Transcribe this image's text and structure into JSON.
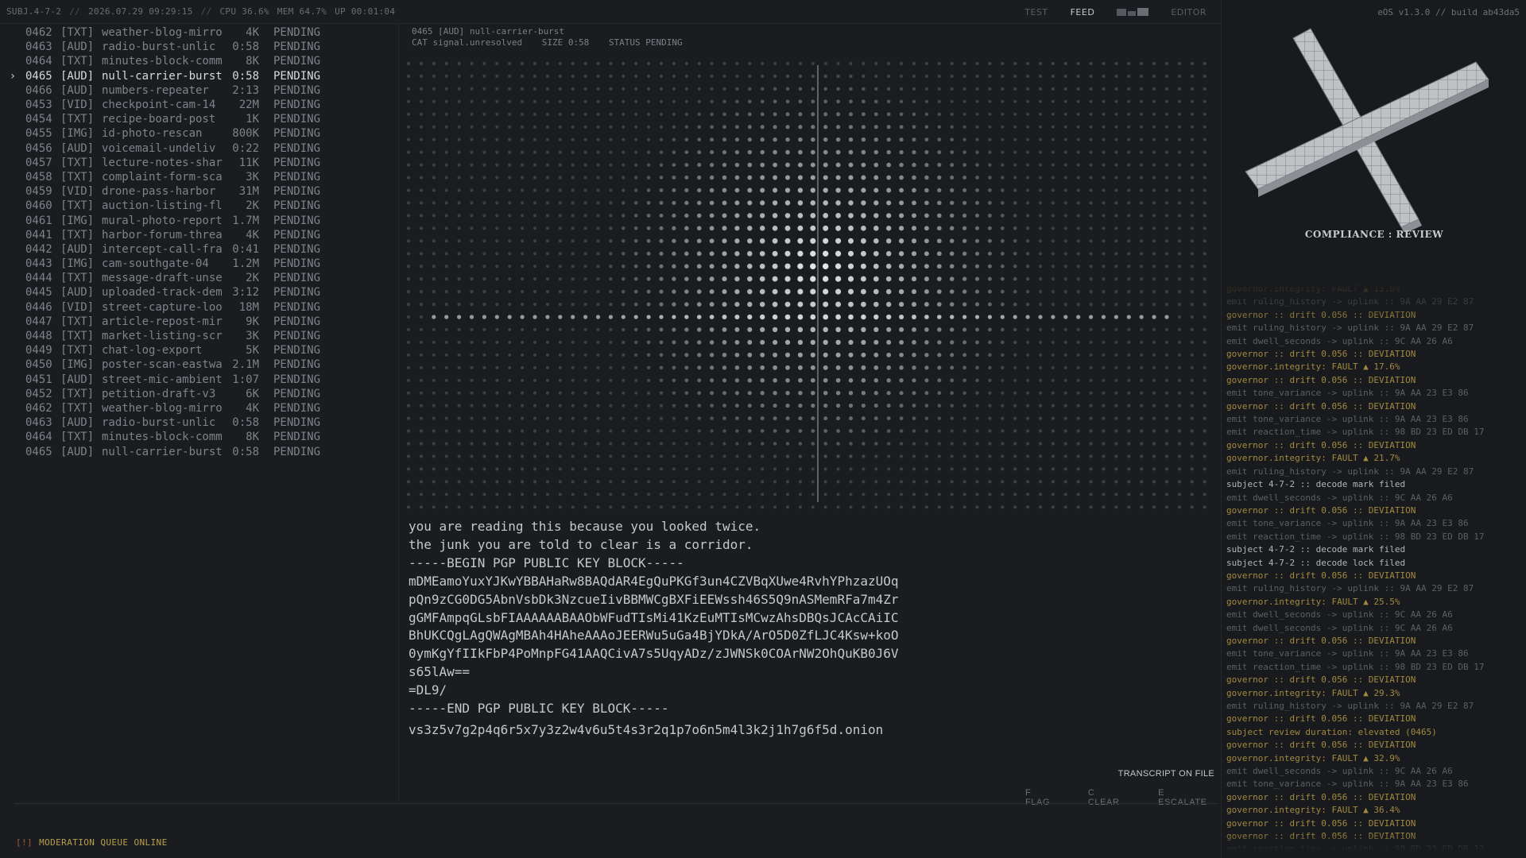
{
  "topbar": {
    "subject": "SUBJ.4-7-2",
    "datetime": "2026.07.29 09:29:15",
    "cpu": "CPU 36.6%",
    "mem": "MEM 64.7%",
    "uptime": "UP 00:01:04",
    "sep": "//",
    "tabs": {
      "test": "TEST",
      "feed": "FEED",
      "editor": "EDITOR"
    }
  },
  "queue": {
    "cursor": "›",
    "selected_index": 3,
    "items": [
      {
        "id": "0462",
        "type": "[TXT]",
        "name": "weather-blog-mirro",
        "size": "4K",
        "status": "PENDING"
      },
      {
        "id": "0463",
        "type": "[AUD]",
        "name": "radio-burst-unlic",
        "size": "0:58",
        "status": "PENDING"
      },
      {
        "id": "0464",
        "type": "[TXT]",
        "name": "minutes-block-comm",
        "size": "8K",
        "status": "PENDING"
      },
      {
        "id": "0465",
        "type": "[AUD]",
        "name": "null-carrier-burst",
        "size": "0:58",
        "status": "PENDING"
      },
      {
        "id": "0466",
        "type": "[AUD]",
        "name": "numbers-repeater",
        "size": "2:13",
        "status": "PENDING"
      },
      {
        "id": "0453",
        "type": "[VID]",
        "name": "checkpoint-cam-14",
        "size": "22M",
        "status": "PENDING"
      },
      {
        "id": "0454",
        "type": "[TXT]",
        "name": "recipe-board-post",
        "size": "1K",
        "status": "PENDING"
      },
      {
        "id": "0455",
        "type": "[IMG]",
        "name": "id-photo-rescan",
        "size": "800K",
        "status": "PENDING"
      },
      {
        "id": "0456",
        "type": "[AUD]",
        "name": "voicemail-undeliv",
        "size": "0:22",
        "status": "PENDING"
      },
      {
        "id": "0457",
        "type": "[TXT]",
        "name": "lecture-notes-shar",
        "size": "11K",
        "status": "PENDING"
      },
      {
        "id": "0458",
        "type": "[TXT]",
        "name": "complaint-form-sca",
        "size": "3K",
        "status": "PENDING"
      },
      {
        "id": "0459",
        "type": "[VID]",
        "name": "drone-pass-harbor",
        "size": "31M",
        "status": "PENDING"
      },
      {
        "id": "0460",
        "type": "[TXT]",
        "name": "auction-listing-fl",
        "size": "2K",
        "status": "PENDING"
      },
      {
        "id": "0461",
        "type": "[IMG]",
        "name": "mural-photo-report",
        "size": "1.7M",
        "status": "PENDING"
      },
      {
        "id": "0441",
        "type": "[TXT]",
        "name": "harbor-forum-threa",
        "size": "4K",
        "status": "PENDING"
      },
      {
        "id": "0442",
        "type": "[AUD]",
        "name": "intercept-call-fra",
        "size": "0:41",
        "status": "PENDING"
      },
      {
        "id": "0443",
        "type": "[IMG]",
        "name": "cam-southgate-04",
        "size": "1.2M",
        "status": "PENDING"
      },
      {
        "id": "0444",
        "type": "[TXT]",
        "name": "message-draft-unse",
        "size": "2K",
        "status": "PENDING"
      },
      {
        "id": "0445",
        "type": "[AUD]",
        "name": "uploaded-track-dem",
        "size": "3:12",
        "status": "PENDING"
      },
      {
        "id": "0446",
        "type": "[VID]",
        "name": "street-capture-loo",
        "size": "18M",
        "status": "PENDING"
      },
      {
        "id": "0447",
        "type": "[TXT]",
        "name": "article-repost-mir",
        "size": "9K",
        "status": "PENDING"
      },
      {
        "id": "0448",
        "type": "[TXT]",
        "name": "market-listing-scr",
        "size": "3K",
        "status": "PENDING"
      },
      {
        "id": "0449",
        "type": "[TXT]",
        "name": "chat-log-export",
        "size": "5K",
        "status": "PENDING"
      },
      {
        "id": "0450",
        "type": "[IMG]",
        "name": "poster-scan-eastwa",
        "size": "2.1M",
        "status": "PENDING"
      },
      {
        "id": "0451",
        "type": "[AUD]",
        "name": "street-mic-ambient",
        "size": "1:07",
        "status": "PENDING"
      },
      {
        "id": "0452",
        "type": "[TXT]",
        "name": "petition-draft-v3",
        "size": "6K",
        "status": "PENDING"
      },
      {
        "id": "0462",
        "type": "[TXT]",
        "name": "weather-blog-mirro",
        "size": "4K",
        "status": "PENDING"
      },
      {
        "id": "0463",
        "type": "[AUD]",
        "name": "radio-burst-unlic",
        "size": "0:58",
        "status": "PENDING"
      },
      {
        "id": "0464",
        "type": "[TXT]",
        "name": "minutes-block-comm",
        "size": "8K",
        "status": "PENDING"
      },
      {
        "id": "0465",
        "type": "[AUD]",
        "name": "null-carrier-burst",
        "size": "0:58",
        "status": "PENDING"
      }
    ]
  },
  "item": {
    "title": "0465 [AUD] null-carrier-burst",
    "cat": "CAT signal.unresolved",
    "size": "SIZE 0:58",
    "status": "STATUS PENDING"
  },
  "message_lines": [
    "you are reading this because you looked twice.",
    "the junk you are told to clear is a corridor.",
    "-----BEGIN PGP PUBLIC KEY BLOCK-----",
    "mDMEamoYuxYJKwYBBAHaRw8BAQdAR4EgQuPKGf3un4CZVBqXUwe4RvhYPhzazUOq",
    "pQn9zCG0DG5AbnVsbDk3NzcueIivBBMWCgBXFiEEWssh46S5Q9nASMemRFa7m4Zr",
    "gGMFAmpqGLsbFIAAAAAABAAObWFudTIsMi41KzEuMTIsMCwzAhsDBQsJCAcCAiIC",
    "BhUKCQgLAgQWAgMBAh4HAheAAAoJEERWu5uGa4BjYDkA/ArO5D0ZfLJC4Ksw+koO",
    "0ymKgYfIIkFbP4PoMnpFG41AAQCivA7s5UqyADz/zJWNSk0COArNW2OhQuKB0J6V",
    "s65lAw==",
    "=DL9/",
    "-----END PGP PUBLIC KEY BLOCK-----",
    "vs3z5v7g2p4q6r5x7y3z2w4v6u5t4s3r2q1p7o6n5m4l3k2j1h7g6f5d.onion"
  ],
  "transcript": "TRANSCRIPT ON FILE",
  "hotkeys": {
    "flag": "F FLAG",
    "clear": "C CLEAR",
    "escalate": "E ESCALATE"
  },
  "queue_status": {
    "bang": "[!]",
    "text": "MODERATION QUEUE ONLINE"
  },
  "right": {
    "build": "eOS v1.3.0 // build ab43da5",
    "compliance": "COMPLIANCE : REVIEW",
    "log": [
      {
        "t": "governor.integrity: FAULT ▲ 13.8%",
        "k": "warn"
      },
      {
        "t": "emit ruling_history -> uplink :: 9A AA 29 E2 87",
        "k": "dim"
      },
      {
        "t": "governor :: drift 0.056 :: DEVIATION",
        "k": "warn"
      },
      {
        "t": "emit ruling_history -> uplink :: 9A AA 29 E2 87",
        "k": "dim"
      },
      {
        "t": "emit dwell_seconds -> uplink :: 9C AA 26 A6",
        "k": "dim"
      },
      {
        "t": "governor :: drift 0.056 :: DEVIATION",
        "k": "warn"
      },
      {
        "t": "governor.integrity: FAULT ▲ 17.6%",
        "k": "warn"
      },
      {
        "t": "governor :: drift 0.056 :: DEVIATION",
        "k": "warn"
      },
      {
        "t": "emit tone_variance -> uplink :: 9A AA 23 E3 86",
        "k": "dim"
      },
      {
        "t": "governor :: drift 0.056 :: DEVIATION",
        "k": "warn"
      },
      {
        "t": "emit tone_variance -> uplink :: 9A AA 23 E3 86",
        "k": "dim"
      },
      {
        "t": "emit reaction_time -> uplink :: 98 BD 23 ED DB 17",
        "k": "dim"
      },
      {
        "t": "governor :: drift 0.056 :: DEVIATION",
        "k": "warn"
      },
      {
        "t": "governor.integrity: FAULT ▲ 21.7%",
        "k": "warn"
      },
      {
        "t": "emit ruling_history -> uplink :: 9A AA 29 E2 87",
        "k": "dim"
      },
      {
        "t": "subject 4-7-2 :: decode mark filed",
        "k": "subject"
      },
      {
        "t": "emit dwell_seconds -> uplink :: 9C AA 26 A6",
        "k": "dim"
      },
      {
        "t": "governor :: drift 0.056 :: DEVIATION",
        "k": "warn"
      },
      {
        "t": "emit tone_variance -> uplink :: 9A AA 23 E3 86",
        "k": "dim"
      },
      {
        "t": "emit reaction_time -> uplink :: 98 BD 23 ED DB 17",
        "k": "dim"
      },
      {
        "t": "subject 4-7-2 :: decode mark filed",
        "k": "subject"
      },
      {
        "t": "subject 4-7-2 :: decode lock filed",
        "k": "subject"
      },
      {
        "t": "governor :: drift 0.056 :: DEVIATION",
        "k": "warn"
      },
      {
        "t": "emit ruling_history -> uplink :: 9A AA 29 E2 87",
        "k": "dim"
      },
      {
        "t": "governor.integrity: FAULT ▲ 25.5%",
        "k": "warn"
      },
      {
        "t": "emit dwell_seconds -> uplink :: 9C AA 26 A6",
        "k": "dim"
      },
      {
        "t": "emit dwell_seconds -> uplink :: 9C AA 26 A6",
        "k": "dim"
      },
      {
        "t": "governor :: drift 0.056 :: DEVIATION",
        "k": "warn"
      },
      {
        "t": "emit tone_variance -> uplink :: 9A AA 23 E3 86",
        "k": "dim"
      },
      {
        "t": "emit reaction_time -> uplink :: 98 BD 23 ED DB 17",
        "k": "dim"
      },
      {
        "t": "governor :: drift 0.056 :: DEVIATION",
        "k": "warn"
      },
      {
        "t": "governor.integrity: FAULT ▲ 29.3%",
        "k": "warn"
      },
      {
        "t": "emit ruling_history -> uplink :: 9A AA 29 E2 87",
        "k": "dim"
      },
      {
        "t": "governor :: drift 0.056 :: DEVIATION",
        "k": "warn"
      },
      {
        "t": "subject review duration: elevated (0465)",
        "k": "warn"
      },
      {
        "t": "governor :: drift 0.056 :: DEVIATION",
        "k": "warn"
      },
      {
        "t": "governor.integrity: FAULT ▲ 32.9%",
        "k": "warn"
      },
      {
        "t": "emit dwell_seconds -> uplink :: 9C AA 26 A6",
        "k": "dim"
      },
      {
        "t": "emit tone_variance -> uplink :: 9A AA 23 E3 86",
        "k": "dim"
      },
      {
        "t": "governor :: drift 0.056 :: DEVIATION",
        "k": "warn"
      },
      {
        "t": "governor.integrity: FAULT ▲ 36.4%",
        "k": "warn"
      },
      {
        "t": "governor :: drift 0.056 :: DEVIATION",
        "k": "warn"
      },
      {
        "t": "governor :: drift 0.056 :: DEVIATION",
        "k": "warn"
      },
      {
        "t": "emit reaction_time -> uplink :: 98 BD 23 ED DB 17",
        "k": "dim"
      }
    ]
  }
}
